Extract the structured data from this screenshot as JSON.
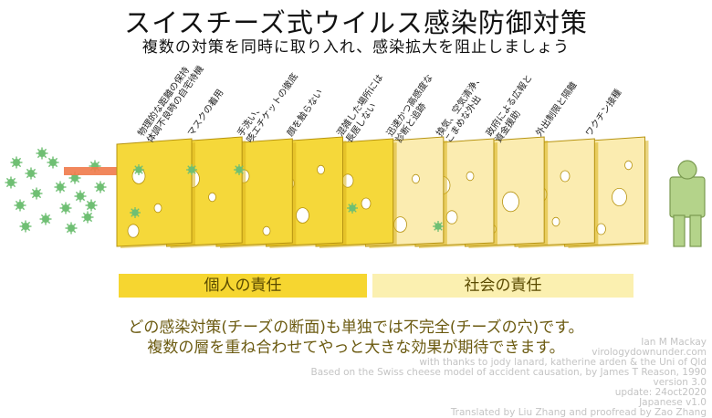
{
  "title": "スイスチーズ式ウイルス感染防御対策",
  "subtitle": "複数の対策を同時に取り入れ、感染拡大を阻止しましょう",
  "layers": [
    {
      "label": "物理的な距離の保持\n体調不良時の自宅待機",
      "group": "personal"
    },
    {
      "label": "マスクの着用",
      "group": "personal"
    },
    {
      "label": "手洗い、\n咳エチケットの徹底",
      "group": "personal"
    },
    {
      "label": "顔を触らない",
      "group": "personal"
    },
    {
      "label": "混雑した場所には\n長居しない",
      "group": "personal"
    },
    {
      "label": "迅速かつ高感度な\n診断と追跡",
      "group": "society"
    },
    {
      "label": "換気、空気清浄、\nこまめな外出",
      "group": "society"
    },
    {
      "label": "政府による広報と\n資金援助",
      "group": "society"
    },
    {
      "label": "外出制限と隔離",
      "group": "society"
    },
    {
      "label": "ワクチン接種",
      "group": "society"
    }
  ],
  "bars": {
    "personal": "個人の責任",
    "society": "社会の責任"
  },
  "caption": {
    "line1": "どの感染対策(チーズの断面)も単独では不完全(チーズの穴)です。",
    "line2": "複数の層を重ね合わせてやっと大きな効果が期待できます。"
  },
  "credits": [
    "Ian M Mackay",
    "virologydownunder.com",
    "with thanks to jody lanard, katherine arden & the Uni of Qld",
    "Based on the Swiss cheese model of accident causation, by James T Reason, 1990",
    "version 3.0",
    "update: 24oct2020",
    "Japanese v1.0",
    "Translated by Liu Zhang and proofread by Zao Zhang"
  ],
  "colors": {
    "personal_cheese": "#f5d83a",
    "society_cheese": "#fbecb0",
    "virus": "#6fbf73",
    "arrow": "#f07a4a",
    "person": "#b4d38a"
  }
}
